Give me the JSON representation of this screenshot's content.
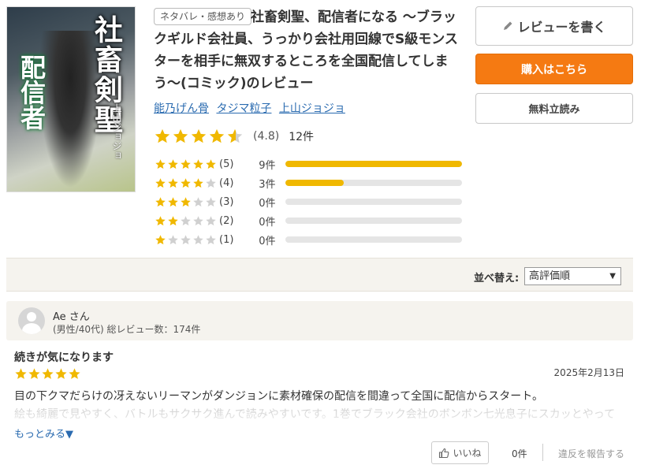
{
  "book": {
    "spoiler_tag": "ネタバレ・感想あり",
    "title": "社畜剣聖、配信者になる ～ブラックギルド会社員、うっかり会社用回線でS級モンスターを相手に無双するところを全国配信してしまう～(コミック)のレビュー",
    "authors": [
      "能乃げん骨",
      "タジマ粒子",
      "上山ジョジョ"
    ],
    "cover": {
      "title_text": "社畜剣聖",
      "subtitle_text": "配信者",
      "author_text": "上山ジョジョ"
    }
  },
  "rating": {
    "average_display": "(4.8)",
    "average": 4.8,
    "count_display": "12件",
    "distribution": [
      {
        "stars": 5,
        "label": "(5)",
        "count_label": "9件",
        "fraction": 1.0
      },
      {
        "stars": 4,
        "label": "(4)",
        "count_label": "3件",
        "fraction": 0.33
      },
      {
        "stars": 3,
        "label": "(3)",
        "count_label": "0件",
        "fraction": 0
      },
      {
        "stars": 2,
        "label": "(2)",
        "count_label": "0件",
        "fraction": 0
      },
      {
        "stars": 1,
        "label": "(1)",
        "count_label": "0件",
        "fraction": 0
      }
    ]
  },
  "actions": {
    "write_review": "レビューを書く",
    "buy": "購入はこちら",
    "free_read": "無料立読み"
  },
  "sort": {
    "label": "並べ替え:",
    "selected": "高評価順"
  },
  "review": {
    "user": "Ae さん",
    "meta": "(男性/40代)  総レビュー数：174件",
    "title": "続きが気になります",
    "stars": 5,
    "date": "2025年2月13日",
    "body_line1": "目の下クマだらけの冴えないリーマンがダンジョンに素材確保の配信を間違って全国に配信からスタート。",
    "body_line2": "絵も綺麗で見やすく、バトルもサクサク進んで読みやすいです。1巻でブラック会社のボンボン七光息子にスカッとやって",
    "more": "もっとみる▼",
    "like_label": "いいね",
    "like_count": "0件",
    "report": "違反を報告する"
  },
  "colors": {
    "star": "#f0b800",
    "star_empty": "#d0d0d0",
    "buy": "#f57a12",
    "link": "#2a6bb0"
  }
}
